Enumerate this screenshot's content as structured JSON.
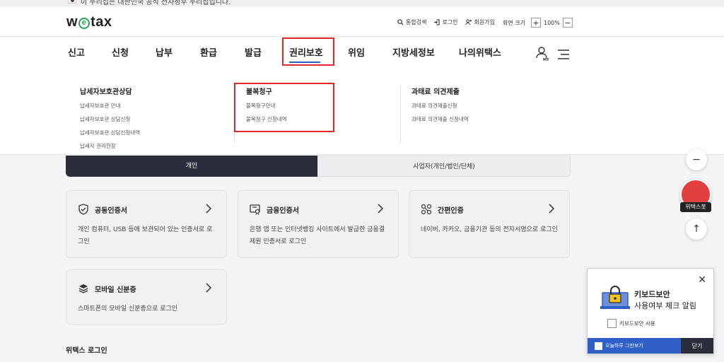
{
  "gov_bar": {
    "text": "이 누리집은 대한민국 공식 전자정부 누리집입니다."
  },
  "header": {
    "logo_left": "w",
    "logo_e": "e",
    "logo_right": "tax",
    "utils": [
      {
        "icon": "search-icon",
        "label": "통합검색"
      },
      {
        "icon": "login-icon",
        "label": "로그인"
      },
      {
        "icon": "user-plus-icon",
        "label": "회원가입"
      }
    ],
    "zoom": {
      "label": "화면 크기",
      "plus": "+",
      "value": "100%",
      "minus": "−"
    }
  },
  "gnb": {
    "items": [
      "신고",
      "신청",
      "납부",
      "환급",
      "발급",
      "권리보호",
      "위임",
      "지방세정보",
      "나의위택스"
    ],
    "active_index": 5,
    "user_icon_label": "MY"
  },
  "mega": {
    "columns": [
      {
        "title": "납세자보호관상담",
        "items": [
          "납세자보호관 안내",
          "납세자보호관 상담신청",
          "납세자보호관 상담신청내역",
          "납세자 권리헌장"
        ]
      },
      {
        "title": "불복청구",
        "items": [
          "불복청구안내",
          "불복청구 신청내역"
        ]
      },
      {
        "title": "과태료 의견제출",
        "items": [
          "과태료 의견제출신청",
          "과태료 의견제출 신청내역"
        ]
      }
    ]
  },
  "tabs": {
    "personal": "개인",
    "business": "사업자(개인/법인/단체)"
  },
  "cards": [
    {
      "icon": "shield-check-icon",
      "title": "공동인증서",
      "desc": "개인 컴퓨터, USB 등에 보관되어 있는 인증서로 로그인"
    },
    {
      "icon": "certificate-icon",
      "title": "금융인증서",
      "desc": "은행 앱 또는 인터넷뱅킹 사이트에서 발급한 금융결제원 인증서로 로그인"
    },
    {
      "icon": "link-nodes-icon",
      "title": "간편인증",
      "desc": "네이버, 카카오, 금융기관 등의 전자서명으로 로그인"
    },
    {
      "icon": "layers-icon",
      "title": "모바일 신분증",
      "desc": "스마트폰의 모바일 신분증으로 로그인"
    }
  ],
  "section_label": "위택스 로그인",
  "floating": {
    "minus": "−",
    "bot_label": "위택스봇",
    "top": "↑"
  },
  "keyboard_popup": {
    "title": "키보드보안",
    "subtitle": "사용여부 체크 알림",
    "checkbox_label": "키보드보안 사용",
    "dont_show": "오늘하루 그만보기",
    "close_btn": "닫기",
    "close_x": "✕"
  },
  "colors": {
    "accent_red": "#e2262c",
    "accent_blue": "#2f5fc9",
    "dark": "#2b2d3a",
    "logo_green": "#27a15a"
  }
}
